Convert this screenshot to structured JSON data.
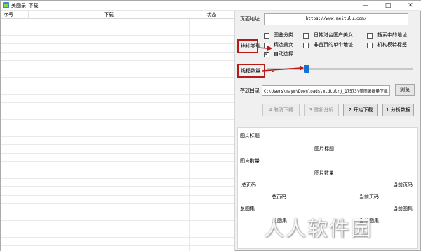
{
  "window": {
    "title": "美图录_下载",
    "min_icon": "—",
    "max_icon": "□",
    "close_icon": "✕"
  },
  "table": {
    "columns": [
      "序号",
      "下载",
      "状态"
    ]
  },
  "form": {
    "page_url_label": "页面地址",
    "page_url_value": "https://www.meitulu.com/",
    "address_type_label": "地址类型",
    "checkboxes": [
      {
        "label": "图鉴分类",
        "checked": false
      },
      {
        "label": "日韩港台国产美女",
        "checked": false
      },
      {
        "label": "搜索中的地址",
        "checked": false
      },
      {
        "label": "精选美女",
        "checked": false
      },
      {
        "label": "非首页的单个地址",
        "checked": false
      },
      {
        "label": "机构模特标签",
        "checked": false
      },
      {
        "label": "自动选择",
        "checked": true
      }
    ],
    "thread_count_label": "线程数量",
    "thread_count_value": "6",
    "slider_level": 0.28,
    "save_dir_label": "存放目录",
    "save_dir_value": "C:\\Users\\maym\\Downloads\\mtdtplrj_17573\\美图录批量下载",
    "browse_button": "浏览",
    "buttons": [
      "4 取消下载",
      "3 重新分析",
      "2 开始下载",
      "1 分析数据"
    ]
  },
  "info": {
    "left_title": "图片标题",
    "center_title": "图片标题",
    "left_count": "图片数量",
    "center_count": "图片数量",
    "total_pages_left": "总页码",
    "total_pages_center": "总页码",
    "current_page_right": "当前页码",
    "current_page_center": "当前页码",
    "total_sets_left": "总图集",
    "total_sets_center": "总图集",
    "current_set_right": "当前图集",
    "current_set_center": "当前图集"
  },
  "watermark": "人人软件园",
  "colors": {
    "annotation": "#b81919",
    "slider_thumb": "#1273d4"
  }
}
